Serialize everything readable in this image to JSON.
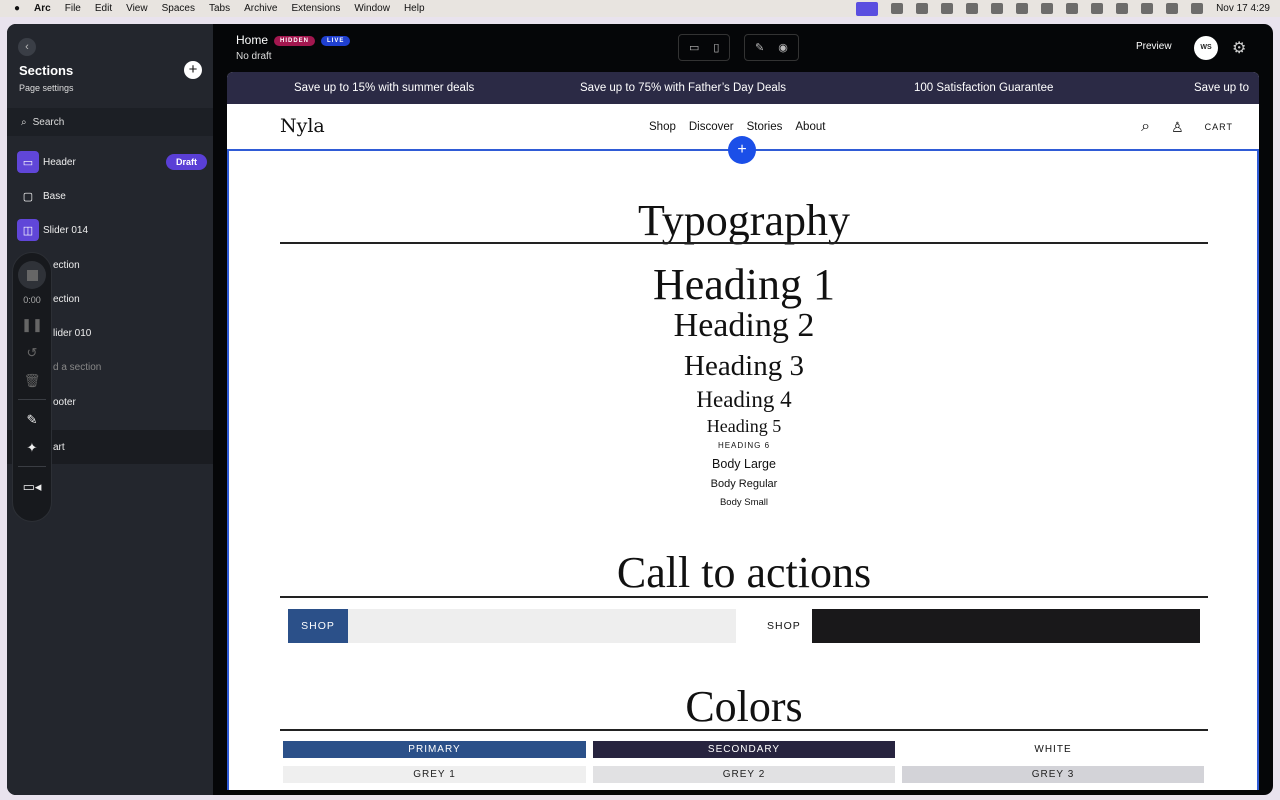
{
  "menubar": {
    "apple": "",
    "app": "Arc",
    "items": [
      "File",
      "Edit",
      "View",
      "Spaces",
      "Tabs",
      "Archive",
      "Extensions",
      "Window",
      "Help"
    ],
    "datetime": "Nov 17  4:29"
  },
  "sidebar": {
    "title": "Sections",
    "page_settings": "Page settings",
    "search": "Search",
    "draft_badge": "Draft",
    "items": [
      {
        "label": "Header"
      },
      {
        "label": "Base"
      },
      {
        "label": "Slider 014"
      },
      {
        "label": "ection"
      },
      {
        "label": "ection"
      },
      {
        "label": "lider 010"
      },
      {
        "label": "d a section"
      },
      {
        "label": "ooter"
      },
      {
        "label": "art"
      }
    ]
  },
  "recorder": {
    "time": "0:00"
  },
  "topbar": {
    "page": "Home",
    "hidden_badge": "HIDDEN",
    "live_badge": "LIVE",
    "draft_status": "No draft",
    "preview": "Preview",
    "avatar": "WS"
  },
  "store": {
    "announcements": [
      "Save up to 15% with summer deals",
      "Save up to 75% with Father’s Day Deals",
      "100 Satisfaction Guarantee",
      "Save up to"
    ],
    "logo": "Nyla",
    "nav": [
      "Shop",
      "Discover",
      "Stories",
      "About"
    ],
    "cart": "CART"
  },
  "typography": {
    "title": "Typography",
    "h1": "Heading 1",
    "h2": "Heading 2",
    "h3": "Heading 3",
    "h4": "Heading 4",
    "h5": "Heading 5",
    "h6": "HEADING 6",
    "body_large": "Body Large",
    "body_regular": "Body Regular",
    "body_small": "Body Small"
  },
  "cta": {
    "title": "Call to actions",
    "primary": "SHOP",
    "secondary": "SHOP"
  },
  "colors": {
    "title": "Colors",
    "swatches": [
      {
        "label": "PRIMARY",
        "color": "#2b5089"
      },
      {
        "label": "SECONDARY",
        "color": "#27243f"
      },
      {
        "label": "WHITE",
        "color": "#ffffff"
      },
      {
        "label": "GREY 1",
        "color": "#efefef"
      },
      {
        "label": "GREY 2",
        "color": "#e1e1e3"
      },
      {
        "label": "GREY 3",
        "color": "#d3d3d8"
      }
    ]
  }
}
